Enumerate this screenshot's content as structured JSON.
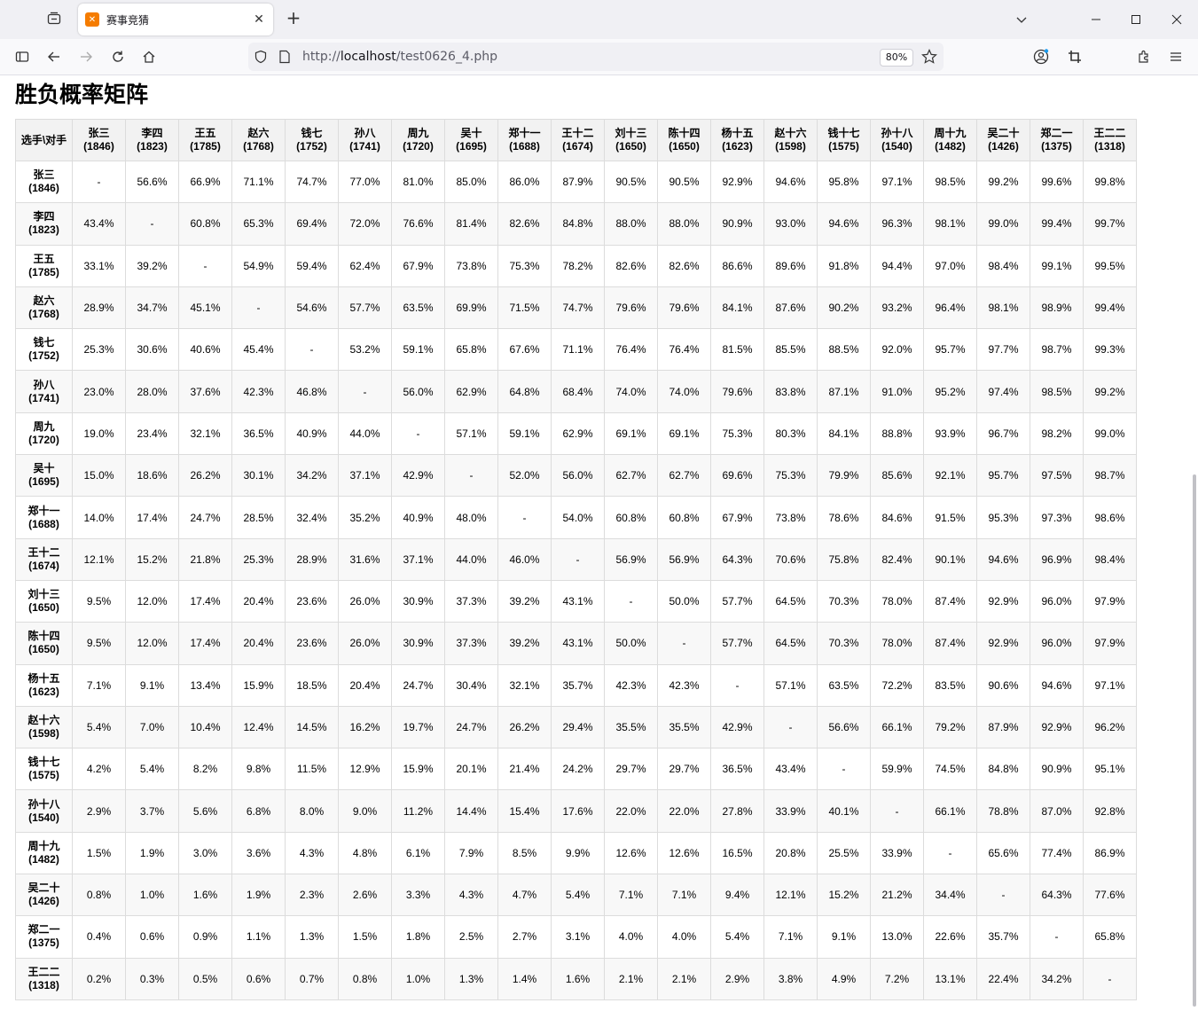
{
  "browser": {
    "tab_title": "赛事竞猜",
    "url_prefix": "http://",
    "url_host": "localhost",
    "url_path": "/test0626_4.php",
    "zoom": "80%",
    "icons": [
      "tab-list-icon",
      "favicon",
      "close-icon",
      "new-tab-icon",
      "chevron-down-icon",
      "minimize-icon",
      "maximize-icon",
      "window-close-icon",
      "sidebar-icon",
      "back-icon",
      "forward-icon",
      "reload-icon",
      "home-icon",
      "shield-icon",
      "page-icon",
      "star-icon",
      "account-icon",
      "screenshot-icon",
      "extensions-icon",
      "menu-icon"
    ]
  },
  "page": {
    "title": "胜负概率矩阵",
    "corner_header": "选手\\对手",
    "players": [
      {
        "name": "张三",
        "rating": "(1846)"
      },
      {
        "name": "李四",
        "rating": "(1823)"
      },
      {
        "name": "王五",
        "rating": "(1785)"
      },
      {
        "name": "赵六",
        "rating": "(1768)"
      },
      {
        "name": "钱七",
        "rating": "(1752)"
      },
      {
        "name": "孙八",
        "rating": "(1741)"
      },
      {
        "name": "周九",
        "rating": "(1720)"
      },
      {
        "name": "吴十",
        "rating": "(1695)"
      },
      {
        "name": "郑十一",
        "rating": "(1688)"
      },
      {
        "name": "王十二",
        "rating": "(1674)"
      },
      {
        "name": "刘十三",
        "rating": "(1650)"
      },
      {
        "name": "陈十四",
        "rating": "(1650)"
      },
      {
        "name": "杨十五",
        "rating": "(1623)"
      },
      {
        "name": "赵十六",
        "rating": "(1598)"
      },
      {
        "name": "钱十七",
        "rating": "(1575)"
      },
      {
        "name": "孙十八",
        "rating": "(1540)"
      },
      {
        "name": "周十九",
        "rating": "(1482)"
      },
      {
        "name": "吴二十",
        "rating": "(1426)"
      },
      {
        "name": "郑二一",
        "rating": "(1375)"
      },
      {
        "name": "王二二",
        "rating": "(1318)"
      }
    ],
    "matrix": [
      [
        "-",
        "56.6%",
        "66.9%",
        "71.1%",
        "74.7%",
        "77.0%",
        "81.0%",
        "85.0%",
        "86.0%",
        "87.9%",
        "90.5%",
        "90.5%",
        "92.9%",
        "94.6%",
        "95.8%",
        "97.1%",
        "98.5%",
        "99.2%",
        "99.6%",
        "99.8%"
      ],
      [
        "43.4%",
        "-",
        "60.8%",
        "65.3%",
        "69.4%",
        "72.0%",
        "76.6%",
        "81.4%",
        "82.6%",
        "84.8%",
        "88.0%",
        "88.0%",
        "90.9%",
        "93.0%",
        "94.6%",
        "96.3%",
        "98.1%",
        "99.0%",
        "99.4%",
        "99.7%"
      ],
      [
        "33.1%",
        "39.2%",
        "-",
        "54.9%",
        "59.4%",
        "62.4%",
        "67.9%",
        "73.8%",
        "75.3%",
        "78.2%",
        "82.6%",
        "82.6%",
        "86.6%",
        "89.6%",
        "91.8%",
        "94.4%",
        "97.0%",
        "98.4%",
        "99.1%",
        "99.5%"
      ],
      [
        "28.9%",
        "34.7%",
        "45.1%",
        "-",
        "54.6%",
        "57.7%",
        "63.5%",
        "69.9%",
        "71.5%",
        "74.7%",
        "79.6%",
        "79.6%",
        "84.1%",
        "87.6%",
        "90.2%",
        "93.2%",
        "96.4%",
        "98.1%",
        "98.9%",
        "99.4%"
      ],
      [
        "25.3%",
        "30.6%",
        "40.6%",
        "45.4%",
        "-",
        "53.2%",
        "59.1%",
        "65.8%",
        "67.6%",
        "71.1%",
        "76.4%",
        "76.4%",
        "81.5%",
        "85.5%",
        "88.5%",
        "92.0%",
        "95.7%",
        "97.7%",
        "98.7%",
        "99.3%"
      ],
      [
        "23.0%",
        "28.0%",
        "37.6%",
        "42.3%",
        "46.8%",
        "-",
        "56.0%",
        "62.9%",
        "64.8%",
        "68.4%",
        "74.0%",
        "74.0%",
        "79.6%",
        "83.8%",
        "87.1%",
        "91.0%",
        "95.2%",
        "97.4%",
        "98.5%",
        "99.2%"
      ],
      [
        "19.0%",
        "23.4%",
        "32.1%",
        "36.5%",
        "40.9%",
        "44.0%",
        "-",
        "57.1%",
        "59.1%",
        "62.9%",
        "69.1%",
        "69.1%",
        "75.3%",
        "80.3%",
        "84.1%",
        "88.8%",
        "93.9%",
        "96.7%",
        "98.2%",
        "99.0%"
      ],
      [
        "15.0%",
        "18.6%",
        "26.2%",
        "30.1%",
        "34.2%",
        "37.1%",
        "42.9%",
        "-",
        "52.0%",
        "56.0%",
        "62.7%",
        "62.7%",
        "69.6%",
        "75.3%",
        "79.9%",
        "85.6%",
        "92.1%",
        "95.7%",
        "97.5%",
        "98.7%"
      ],
      [
        "14.0%",
        "17.4%",
        "24.7%",
        "28.5%",
        "32.4%",
        "35.2%",
        "40.9%",
        "48.0%",
        "-",
        "54.0%",
        "60.8%",
        "60.8%",
        "67.9%",
        "73.8%",
        "78.6%",
        "84.6%",
        "91.5%",
        "95.3%",
        "97.3%",
        "98.6%"
      ],
      [
        "12.1%",
        "15.2%",
        "21.8%",
        "25.3%",
        "28.9%",
        "31.6%",
        "37.1%",
        "44.0%",
        "46.0%",
        "-",
        "56.9%",
        "56.9%",
        "64.3%",
        "70.6%",
        "75.8%",
        "82.4%",
        "90.1%",
        "94.6%",
        "96.9%",
        "98.4%"
      ],
      [
        "9.5%",
        "12.0%",
        "17.4%",
        "20.4%",
        "23.6%",
        "26.0%",
        "30.9%",
        "37.3%",
        "39.2%",
        "43.1%",
        "-",
        "50.0%",
        "57.7%",
        "64.5%",
        "70.3%",
        "78.0%",
        "87.4%",
        "92.9%",
        "96.0%",
        "97.9%"
      ],
      [
        "9.5%",
        "12.0%",
        "17.4%",
        "20.4%",
        "23.6%",
        "26.0%",
        "30.9%",
        "37.3%",
        "39.2%",
        "43.1%",
        "50.0%",
        "-",
        "57.7%",
        "64.5%",
        "70.3%",
        "78.0%",
        "87.4%",
        "92.9%",
        "96.0%",
        "97.9%"
      ],
      [
        "7.1%",
        "9.1%",
        "13.4%",
        "15.9%",
        "18.5%",
        "20.4%",
        "24.7%",
        "30.4%",
        "32.1%",
        "35.7%",
        "42.3%",
        "42.3%",
        "-",
        "57.1%",
        "63.5%",
        "72.2%",
        "83.5%",
        "90.6%",
        "94.6%",
        "97.1%"
      ],
      [
        "5.4%",
        "7.0%",
        "10.4%",
        "12.4%",
        "14.5%",
        "16.2%",
        "19.7%",
        "24.7%",
        "26.2%",
        "29.4%",
        "35.5%",
        "35.5%",
        "42.9%",
        "-",
        "56.6%",
        "66.1%",
        "79.2%",
        "87.9%",
        "92.9%",
        "96.2%"
      ],
      [
        "4.2%",
        "5.4%",
        "8.2%",
        "9.8%",
        "11.5%",
        "12.9%",
        "15.9%",
        "20.1%",
        "21.4%",
        "24.2%",
        "29.7%",
        "29.7%",
        "36.5%",
        "43.4%",
        "-",
        "59.9%",
        "74.5%",
        "84.8%",
        "90.9%",
        "95.1%"
      ],
      [
        "2.9%",
        "3.7%",
        "5.6%",
        "6.8%",
        "8.0%",
        "9.0%",
        "11.2%",
        "14.4%",
        "15.4%",
        "17.6%",
        "22.0%",
        "22.0%",
        "27.8%",
        "33.9%",
        "40.1%",
        "-",
        "66.1%",
        "78.8%",
        "87.0%",
        "92.8%"
      ],
      [
        "1.5%",
        "1.9%",
        "3.0%",
        "3.6%",
        "4.3%",
        "4.8%",
        "6.1%",
        "7.9%",
        "8.5%",
        "9.9%",
        "12.6%",
        "12.6%",
        "16.5%",
        "20.8%",
        "25.5%",
        "33.9%",
        "-",
        "65.6%",
        "77.4%",
        "86.9%"
      ],
      [
        "0.8%",
        "1.0%",
        "1.6%",
        "1.9%",
        "2.3%",
        "2.6%",
        "3.3%",
        "4.3%",
        "4.7%",
        "5.4%",
        "7.1%",
        "7.1%",
        "9.4%",
        "12.1%",
        "15.2%",
        "21.2%",
        "34.4%",
        "-",
        "64.3%",
        "77.6%"
      ],
      [
        "0.4%",
        "0.6%",
        "0.9%",
        "1.1%",
        "1.3%",
        "1.5%",
        "1.8%",
        "2.5%",
        "2.7%",
        "3.1%",
        "4.0%",
        "4.0%",
        "5.4%",
        "7.1%",
        "9.1%",
        "13.0%",
        "22.6%",
        "35.7%",
        "-",
        "65.8%"
      ],
      [
        "0.2%",
        "0.3%",
        "0.5%",
        "0.6%",
        "0.7%",
        "0.8%",
        "1.0%",
        "1.3%",
        "1.4%",
        "1.6%",
        "2.1%",
        "2.1%",
        "2.9%",
        "3.8%",
        "4.9%",
        "7.2%",
        "13.1%",
        "22.4%",
        "34.2%",
        "-"
      ]
    ]
  }
}
